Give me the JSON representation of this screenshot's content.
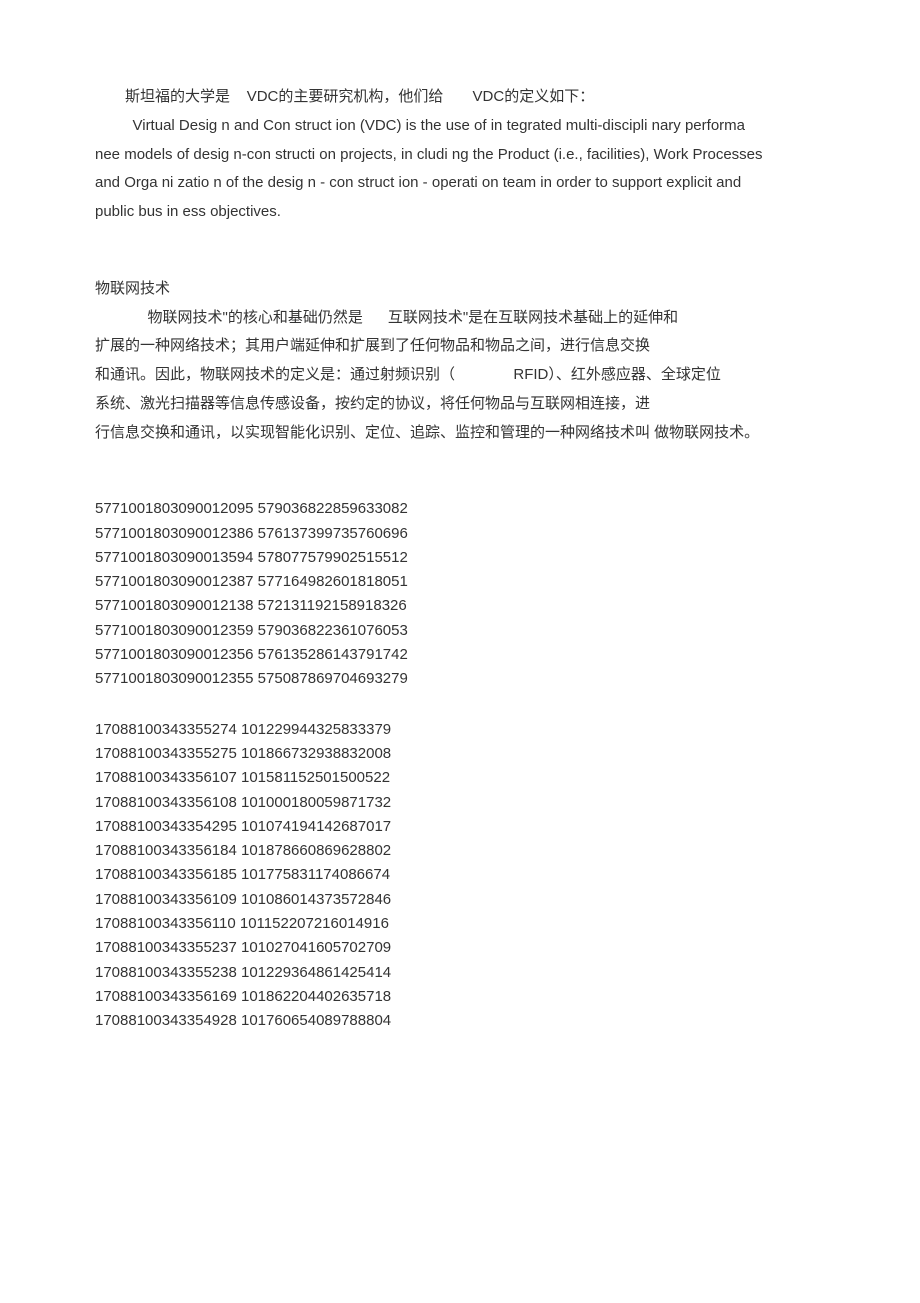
{
  "p1": {
    "line1_a": "斯坦福的大学是",
    "line1_b": "VDC的主要研究机构，他们给",
    "line1_c": "VDC的定义如下：",
    "line2": "Virtual Desig n and Con struct ion (VDC) is the use of in tegrated multi-discipli nary performa",
    "line3": "nee models of desig n-con structi on projects, in cludi ng the Product (i.e., facilities), Work Processes",
    "line4": "and Orga ni zatio n of the desig n - con struct ion - operati on team in order to support explicit and",
    "line5": "public bus in ess objectives."
  },
  "h2": "物联网技术",
  "p2": {
    "line1_a": "物联网技术\"的核心和基础仍然是",
    "line1_b": "互联网技术\"是在互联网技术基础上的延伸和",
    "line2": "扩展的一种网络技术；其用户端延伸和扩展到了任何物品和物品之间，进行信息交换",
    "line3_a": "和通讯。因此，物联网技术的定义是：通过射频识别（",
    "line3_b": "RFID）、红外感应器、全球定位",
    "line4": "系统、激光扫描器等信息传感设备，按约定的协议，将任何物品与互联网相连接，进",
    "line5": "行信息交换和通讯，以实现智能化识别、定位、追踪、监控和管理的一种网络技术叫 做物联网技术。"
  },
  "block1": [
    "5771001803090012095 579036822859633082",
    "5771001803090012386 576137399735760696",
    "5771001803090013594 578077579902515512",
    "5771001803090012387 577164982601818051",
    "5771001803090012138 572131192158918326",
    "5771001803090012359 579036822361076053",
    "5771001803090012356 576135286143791742",
    "5771001803090012355 575087869704693279"
  ],
  "block2": [
    "17088100343355274 101229944325833379",
    "17088100343355275 101866732938832008",
    "17088100343356107 101581152501500522",
    "17088100343356108 101000180059871732",
    "17088100343354295 101074194142687017",
    "17088100343356184 101878660869628802",
    "17088100343356185 101775831174086674",
    "17088100343356109 101086014373572846",
    "17088100343356110 101152207216014916",
    "17088100343355237 101027041605702709",
    "17088100343355238 101229364861425414",
    "17088100343356169 101862204402635718",
    "17088100343354928 101760654089788804"
  ]
}
